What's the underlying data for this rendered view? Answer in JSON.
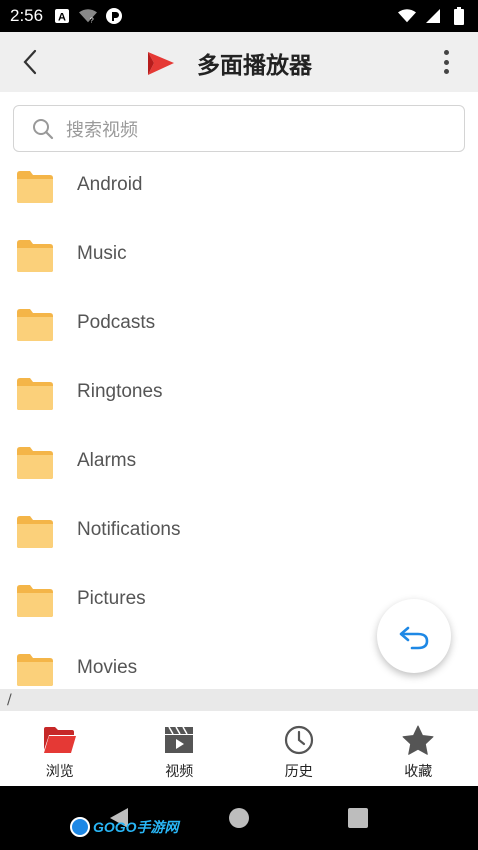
{
  "status_bar": {
    "time": "2:56"
  },
  "app_bar": {
    "title": "多面播放器"
  },
  "search": {
    "placeholder": "搜索视频"
  },
  "folders": [
    {
      "name": "Android"
    },
    {
      "name": "Music"
    },
    {
      "name": "Podcasts"
    },
    {
      "name": "Ringtones"
    },
    {
      "name": "Alarms"
    },
    {
      "name": "Notifications"
    },
    {
      "name": "Pictures"
    },
    {
      "name": "Movies"
    }
  ],
  "path_bar": {
    "path": "/"
  },
  "bottom_nav": {
    "items": [
      {
        "label": "浏览",
        "icon": "folder-open-icon",
        "active": true
      },
      {
        "label": "视频",
        "icon": "video-clapper-icon",
        "active": false
      },
      {
        "label": "历史",
        "icon": "clock-icon",
        "active": false
      },
      {
        "label": "收藏",
        "icon": "star-icon",
        "active": false
      }
    ]
  },
  "watermark": {
    "text": "GOGO手游网"
  },
  "colors": {
    "accent": "#e53935",
    "folder": "#f7c566",
    "fab_icon": "#1e88e5"
  }
}
